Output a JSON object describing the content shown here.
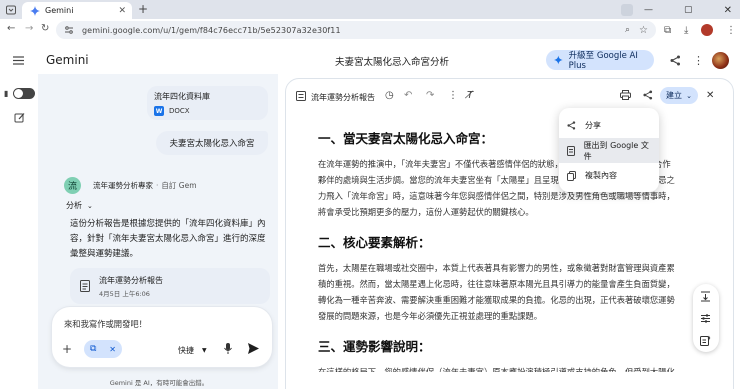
{
  "browser": {
    "tab_title": "Gemini",
    "url": "gemini.google.com/u/1/gem/f84c76ecc71b/5e52307a32e30f11"
  },
  "header": {
    "brand": "Gemini",
    "chat_title": "夫妻宮太陽化忌入命宮分析",
    "upgrade_label": "升級至 Google AI Plus"
  },
  "chat": {
    "file_card": {
      "title": "流年四化資料庫",
      "type": "DOCX",
      "type_badge": "W"
    },
    "user_message": "夫妻宮太陽化忌入命宮",
    "gem": {
      "initial": "流",
      "name": "流年運勢分析專家",
      "sep": "·",
      "tag": "自訂 Gem"
    },
    "analysis_label": "分析",
    "reply": "這份分析報告是根據您提供的「流年四化資料庫」內容，針對「流年夫妻宮太陽化忌入命宮」進行的深度彙整與運勢建議。",
    "doc_chip": {
      "title": "流年運勢分析報告",
      "date": "4月5日 上午6:06"
    },
    "input_placeholder": "來和我寫作或開發吧！",
    "mode_label": "快捷",
    "disclaimer": "Gemini 是 AI，有時可能會出錯。"
  },
  "canvas": {
    "doc_title": "流年運勢分析報告",
    "create_label": "建立"
  },
  "document": {
    "sections": [
      {
        "heading": "一、當天妻宮太陽化忌入命宮：",
        "body": "在流年運勢的推演中，「流年夫妻宮」不僅代表著感情伴侶的狀態，也代表著事業上的對手或合作夥伴的處境與生活步調。當您的流年夫妻宮坐有「太陽星」且呈現「化忌」狀態，並將這份化忌之力飛入「流年命宮」時，這意味著今年您與感情伴侶之間，特別是涉及男性角色或職場等情事時，將會承受比預期更多的壓力，這份人運勢起伏的關鍵核心。"
      },
      {
        "heading": "二、核心要素解析：",
        "body": "首先，太陽星在職場或社交圈中，本質上代表著具有影響力的男性，或象徵著對財富管理與資產累積的重視。然而，當太陽星遇上化忌時，往往意味著原本陽光且具引導力的能量會產生負面質變，轉化為一種辛苦奔波、需要解決重重困難才能獲取成果的負擔。化忌的出現，正代表著破壞您運勢發展的問題來源，也是今年必須優先正視並處理的重點課題。"
      },
      {
        "heading": "三、運勢影響說明：",
        "body": "在這樣的格局下，您的感情伴侶（流年夫妻宮）原本應扮演積極引導或支持的角色，但受到太陽化忌的影響，伴侶在賺錢或事業經營的過程中，可能會陷入極度辛苦的境地，必須耗費大量精力"
      }
    ]
  },
  "share_menu": {
    "items": [
      {
        "label": "分享",
        "icon": "share-icon"
      },
      {
        "label": "匯出到 Google 文件",
        "icon": "document-icon"
      },
      {
        "label": "複製內容",
        "icon": "copy-icon"
      }
    ]
  },
  "colors": {
    "accent": "#0b57d0",
    "chat_bg": "#f0f4f9",
    "chip_bg": "#e9eef6",
    "upgrade_bg": "#d3e3fd",
    "gem_icon_bg": "#7fcfb3"
  }
}
